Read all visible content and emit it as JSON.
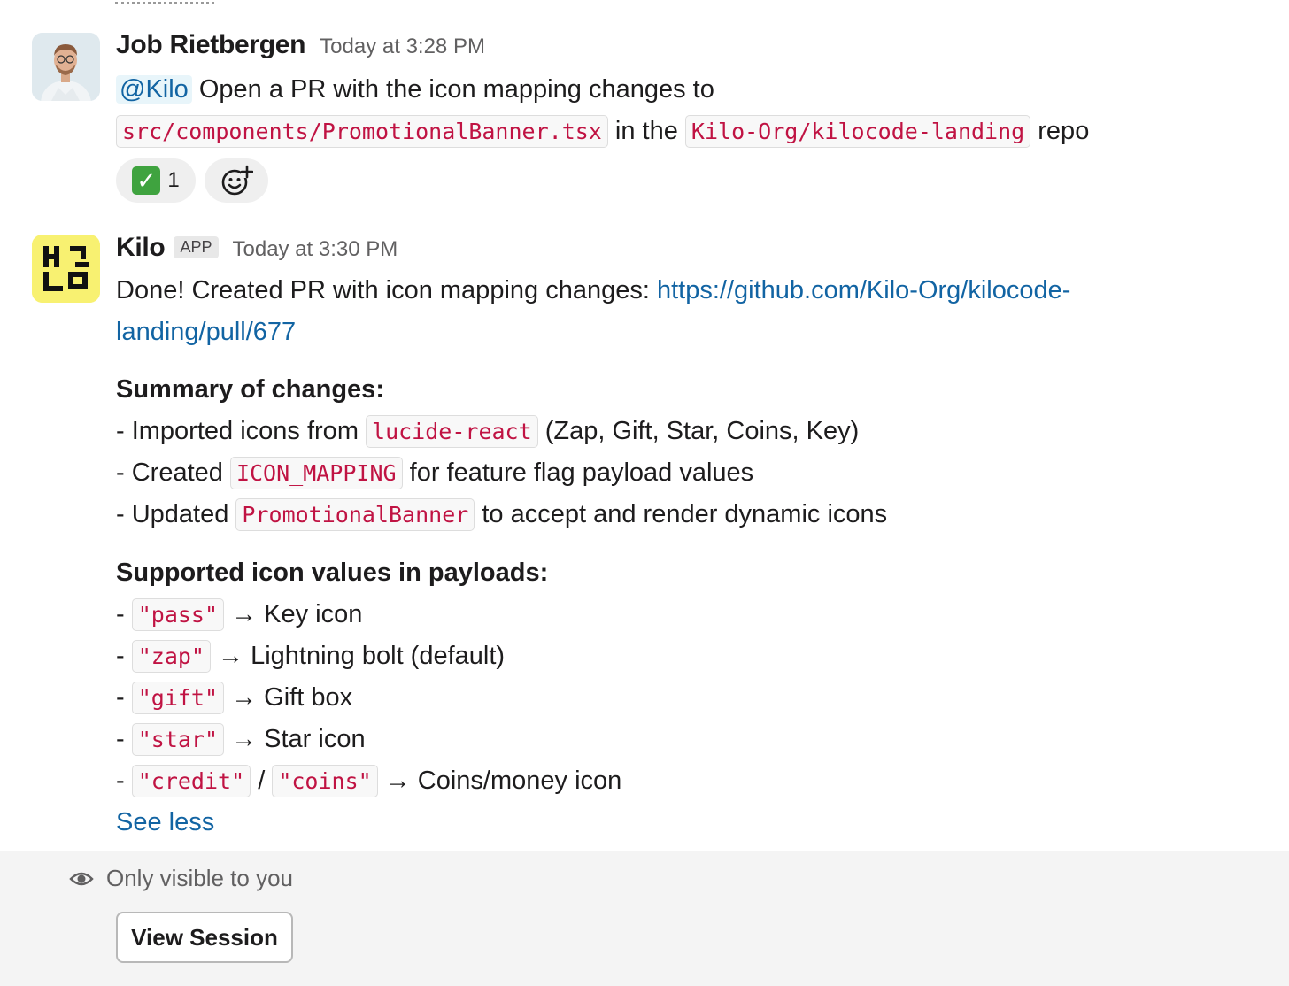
{
  "message1": {
    "author": "Job Rietbergen",
    "timestamp": "Today at 3:28 PM",
    "mention": "@Kilo",
    "text_1": " Open a PR with the icon mapping changes to",
    "code_file": "src/components/PromotionalBanner.tsx",
    "text_2": " in the ",
    "code_repo": "Kilo-Org/kilocode-landing",
    "text_3": " repo",
    "reactions": [
      {
        "emoji": "white-check-mark",
        "count": "1"
      },
      {
        "emoji": "add-reaction"
      }
    ]
  },
  "message2": {
    "author": "Kilo",
    "badge": "APP",
    "timestamp": "Today at 3:30 PM",
    "intro": "Done! Created PR with icon mapping changes: ",
    "link_part1": "https://github.com/Kilo-Org/kilocode-",
    "link_part2": "landing/pull/677",
    "summary_heading": "Summary of changes:",
    "summary_items": [
      {
        "prefix": "- Imported icons from ",
        "code": "lucide-react",
        "suffix": " (Zap, Gift, Star, Coins, Key)"
      },
      {
        "prefix": "- Created ",
        "code": "ICON_MAPPING",
        "suffix": " for feature flag payload values"
      },
      {
        "prefix": "- Updated ",
        "code": "PromotionalBanner",
        "suffix": " to accept and render dynamic icons"
      }
    ],
    "supported_heading": "Supported icon values in payloads:",
    "supported_items": [
      {
        "code": "\"pass\"",
        "desc": " → Key icon"
      },
      {
        "code": "\"zap\"",
        "desc": " → Lightning bolt (default)"
      },
      {
        "code": "\"gift\"",
        "desc": " → Gift box"
      },
      {
        "code": "\"star\"",
        "desc": " → Star icon"
      },
      {
        "code": "\"credit\"",
        "code2": "\"coins\"",
        "separator": " / ",
        "desc": " → Coins/money icon"
      }
    ],
    "see_less": "See less",
    "ephemeral_note": "Only visible to you",
    "view_session_button": "View Session"
  }
}
